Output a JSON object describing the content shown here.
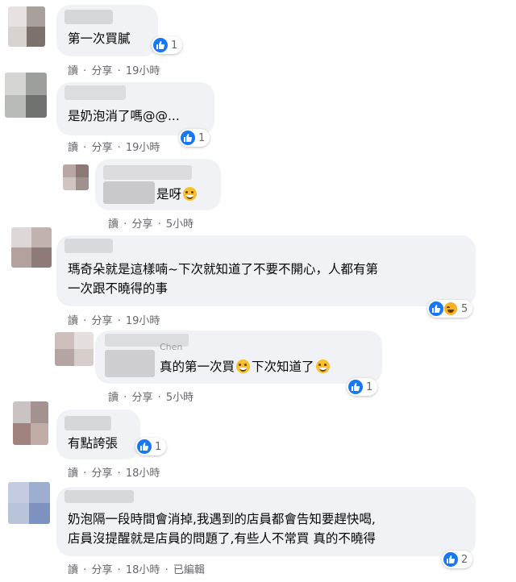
{
  "comments": [
    {
      "id": "c1",
      "text": "第一次買膩",
      "reaction_count": "1",
      "action_read": "讀",
      "action_share": "分享",
      "time": "19小時"
    },
    {
      "id": "c2",
      "text": "是奶泡消了嗎@@...",
      "reaction_count": "1",
      "action_read": "讀",
      "action_share": "分享",
      "time": "19小時"
    },
    {
      "id": "c3",
      "text": "是呀",
      "action_read": "讀",
      "action_share": "分享",
      "time": "5小時"
    },
    {
      "id": "c4",
      "line1": "瑪奇朵就是這樣喃~下次就知道了不要不開心，人都有第",
      "line2": "一次跟不曉得的事",
      "reaction_count": "5",
      "action_read": "讀",
      "action_share": "分享",
      "time": "19小時"
    },
    {
      "id": "c5",
      "text_a": "真的第一次買",
      "text_b": "下次知道了",
      "partial_name": "Chen",
      "reaction_count": "1",
      "action_read": "讀",
      "action_share": "分享",
      "time": "5小時"
    },
    {
      "id": "c6",
      "text": "有點誇張",
      "reaction_count": "1",
      "action_read": "讀",
      "action_share": "分享",
      "time": "18小時"
    },
    {
      "id": "c7",
      "line1": "奶泡隔一段時間會消掉,我遇到的店員都會告知要趕快喝,",
      "line2": "店員沒提醒就是店員的問題了,有些人不常買 真的不曉得",
      "reaction_count": "2",
      "action_read": "讀",
      "action_share": "分享",
      "time": "18小時",
      "edited": "已編輯"
    }
  ],
  "separator": "·",
  "icons": {
    "like": "like-icon",
    "haha": "haha-icon",
    "grin": "grinning-emoji"
  },
  "colors": {
    "bubble": "#f0f2f5",
    "like_blue": "#1877f2",
    "meta_gray": "#65676b"
  }
}
